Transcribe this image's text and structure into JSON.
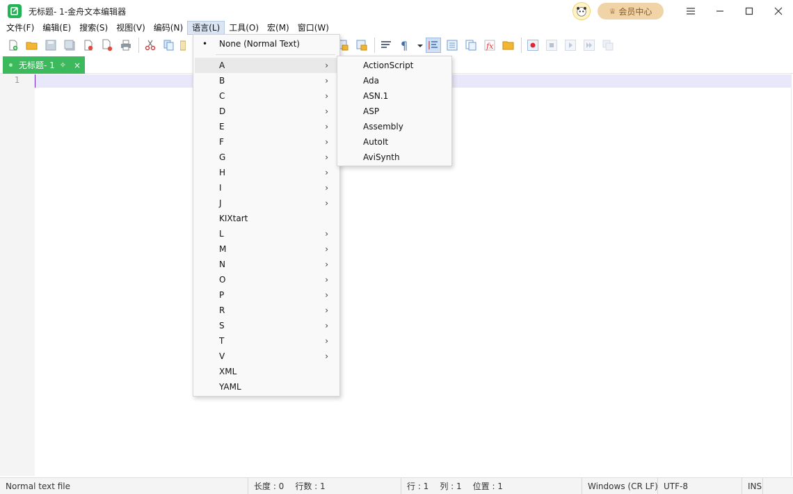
{
  "window": {
    "title": "无标题- 1-金舟文本编辑器",
    "vip_label": "会员中心"
  },
  "menubar": {
    "items": [
      "文件(F)",
      "编辑(E)",
      "搜索(S)",
      "视图(V)",
      "编码(N)",
      "语言(L)",
      "工具(O)",
      "宏(M)",
      "窗口(W)"
    ],
    "active": "语言(L)"
  },
  "tab": {
    "label": "无标题- 1",
    "close": "×"
  },
  "editor": {
    "line_numbers": [
      "1"
    ]
  },
  "language_menu": {
    "top_item": "None (Normal Text)",
    "items": [
      {
        "label": "A",
        "submenu": true
      },
      {
        "label": "B",
        "submenu": true
      },
      {
        "label": "C",
        "submenu": true
      },
      {
        "label": "D",
        "submenu": true
      },
      {
        "label": "E",
        "submenu": true
      },
      {
        "label": "F",
        "submenu": true
      },
      {
        "label": "G",
        "submenu": true
      },
      {
        "label": "H",
        "submenu": true
      },
      {
        "label": "I",
        "submenu": true
      },
      {
        "label": "J",
        "submenu": true
      },
      {
        "label": "KIXtart",
        "submenu": false
      },
      {
        "label": "L",
        "submenu": true
      },
      {
        "label": "M",
        "submenu": true
      },
      {
        "label": "N",
        "submenu": true
      },
      {
        "label": "O",
        "submenu": true
      },
      {
        "label": "P",
        "submenu": true
      },
      {
        "label": "R",
        "submenu": true
      },
      {
        "label": "S",
        "submenu": true
      },
      {
        "label": "T",
        "submenu": true
      },
      {
        "label": "V",
        "submenu": true
      },
      {
        "label": "XML",
        "submenu": false
      },
      {
        "label": "YAML",
        "submenu": false
      }
    ],
    "hovered": "A"
  },
  "submenu_a": {
    "items": [
      "ActionScript",
      "Ada",
      "ASN.1",
      "ASP",
      "Assembly",
      "AutoIt",
      "AviSynth"
    ]
  },
  "statusbar": {
    "file_type": "Normal text file",
    "length": "长度 : 0",
    "lines": "行数 : 1",
    "row": "行 : 1",
    "col": "列 : 1",
    "pos": "位置 : 1",
    "eol": "Windows (CR LF)",
    "encoding": "UTF-8",
    "mode": "INS"
  },
  "colors": {
    "accent_green": "#3cb95c",
    "vip_bg": "#f1d3a8"
  }
}
